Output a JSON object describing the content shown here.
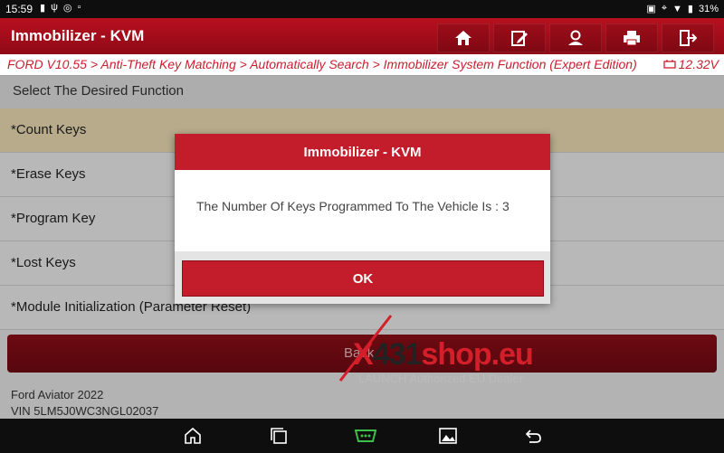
{
  "status_bar": {
    "time": "15:59",
    "battery": "31%"
  },
  "title_bar": {
    "title": "Immobilizer - KVM",
    "buttons": [
      "home-icon",
      "edit-report-icon",
      "user-icon",
      "print-icon",
      "exit-icon"
    ]
  },
  "breadcrumb": {
    "path": "FORD V10.55 > Anti-Theft Key Matching > Automatically Search > Immobilizer System Function (Expert Edition)",
    "voltage": "12.32V"
  },
  "function_list": {
    "header": "Select The Desired Function",
    "items": [
      {
        "label": "*Count Keys",
        "selected": true
      },
      {
        "label": "*Erase Keys",
        "selected": false
      },
      {
        "label": "*Program Key",
        "selected": false
      },
      {
        "label": "*Lost Keys",
        "selected": false
      },
      {
        "label": "*Module Initialization (Parameter Reset)",
        "selected": false
      }
    ]
  },
  "back_button": {
    "label": "Back"
  },
  "vehicle": {
    "model": "Ford Aviator 2022",
    "vin": "VIN 5LM5J0WC3NGL02037"
  },
  "dialog": {
    "title": "Immobilizer - KVM",
    "message": "The Number Of Keys Programmed To The Vehicle Is : 3",
    "ok_label": "OK"
  },
  "watermark": {
    "brand_red_part": "X",
    "brand_dark_part": "431",
    "brand_suffix": "shop.eu",
    "tagline": "LAUNCH Authorized EU Dealer"
  },
  "colors": {
    "title_red": "#b8101f",
    "dialog_red": "#c31c2a",
    "breadcrumb_red": "#c8202f",
    "selected_row": "#ecdcb4",
    "nav_active_green": "#3fbf4a"
  }
}
